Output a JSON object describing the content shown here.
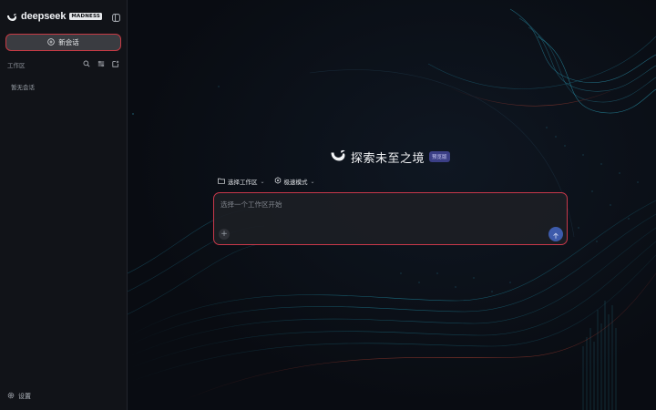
{
  "sidebar": {
    "brand": {
      "name": "deepseek",
      "tag": "MADNESS",
      "logo_icon": "whale-logo-icon"
    },
    "collapse_icon": "sidebar-toggle-icon",
    "new_chat_label": "新会话",
    "workspace_label": "工作区",
    "workspace_tools": [
      "search-icon",
      "sort-icon",
      "new-folder-icon"
    ],
    "empty_label": "暂无会话",
    "settings_label": "设置"
  },
  "main": {
    "hero_title": "探索未至之境",
    "hero_badge": "预览版",
    "workspace_selector": "选择工作区",
    "mode_selector": "极速模式",
    "composer": {
      "placeholder": "选择一个工作区开始",
      "attach_icon": "plus-icon",
      "send_icon": "arrow-up-icon"
    }
  },
  "colors": {
    "accent_border": "#c8384a",
    "send_button": "#3d5bab",
    "badge": "#3b3f86"
  }
}
